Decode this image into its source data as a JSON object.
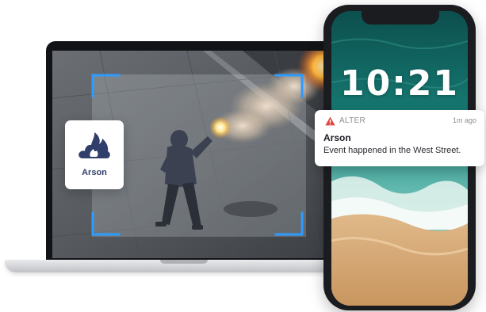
{
  "detection": {
    "icon": "fire-icon",
    "label": "Arson",
    "icon_color": "#2f3e6b",
    "bracket_color": "#2e9bff"
  },
  "phone": {
    "lock_time": "10:21"
  },
  "notification": {
    "icon": "alert-triangle-icon",
    "app_name": "ALTER",
    "time": "1m ago",
    "title": "Arson",
    "body": "Event happened in the West Street.",
    "accent": "#e0443a"
  }
}
